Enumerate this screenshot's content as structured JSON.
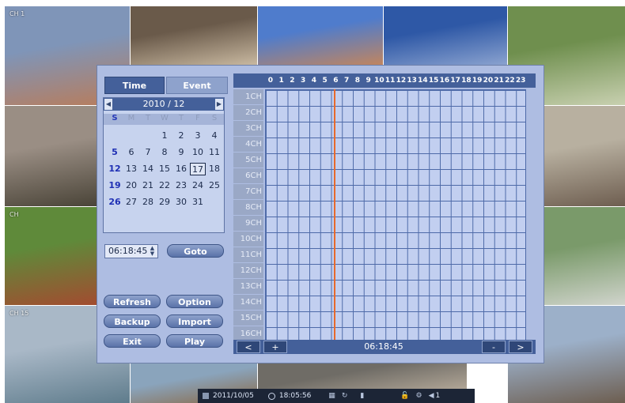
{
  "camera_tiles": [
    {
      "label": "CH 1",
      "colors": [
        "#7f95b8",
        "#b97c5a"
      ]
    },
    {
      "label": "",
      "colors": [
        "#6a5a4a",
        "#c8b8a0"
      ]
    },
    {
      "label": "",
      "colors": [
        "#4f7ccc",
        "#c08560"
      ]
    },
    {
      "label": "",
      "colors": [
        "#2e58a6",
        "#8aa2cf"
      ]
    },
    {
      "label": "",
      "colors": [
        "#6f8f4e",
        "#c8d0b0"
      ]
    },
    {
      "label": "",
      "colors": [
        "#9a8e84",
        "#4a4438"
      ]
    },
    {
      "label": "",
      "colors": [
        "#b8b0a0",
        "#6e5e50"
      ]
    },
    {
      "label": "CH",
      "colors": [
        "#5f8a3a",
        "#a24c30"
      ]
    },
    {
      "label": "",
      "colors": [
        "#7a9a6a",
        "#d0d4cc"
      ]
    },
    {
      "label": "CH 15",
      "colors": [
        "#a9b8c7",
        "#5f7c8c"
      ]
    },
    {
      "label": "",
      "colors": [
        "#8aa4bc",
        "#8a6a48"
      ]
    },
    {
      "label": "",
      "colors": [
        "#6f6c66",
        "#b0a596"
      ]
    },
    {
      "label": "",
      "colors": [
        "#9cb0c9",
        "#6d5e50"
      ]
    }
  ],
  "status_bar": {
    "date": "2011/10/05",
    "time": "18:05:56",
    "channel": "1"
  },
  "tabs": [
    {
      "label": "Time",
      "active": true
    },
    {
      "label": "Event",
      "active": false
    }
  ],
  "calendar": {
    "month_label": "2010 / 12",
    "weekdays": [
      "S",
      "M",
      "T",
      "W",
      "T",
      "F",
      "S"
    ],
    "weeks": [
      [
        "",
        "",
        "",
        "1",
        "2",
        "3",
        "4"
      ],
      [
        "5",
        "6",
        "7",
        "8",
        "9",
        "10",
        "11"
      ],
      [
        "12",
        "13",
        "14",
        "15",
        "16",
        "17",
        "18"
      ],
      [
        "19",
        "20",
        "21",
        "22",
        "23",
        "24",
        "25"
      ],
      [
        "26",
        "27",
        "28",
        "29",
        "30",
        "31",
        ""
      ]
    ],
    "selected_day": "17"
  },
  "time_input": {
    "value": "06:18:45"
  },
  "goto_label": "Goto",
  "action_buttons": {
    "refresh": "Refresh",
    "option": "Option",
    "backup": "Backup",
    "import": "Import",
    "exit": "Exit",
    "play": "Play"
  },
  "timeline": {
    "hours": [
      "0",
      "1",
      "2",
      "3",
      "4",
      "5",
      "6",
      "7",
      "8",
      "9",
      "10",
      "11",
      "12",
      "13",
      "14",
      "15",
      "16",
      "17",
      "18",
      "19",
      "20",
      "21",
      "22",
      "23"
    ],
    "channels": [
      "1CH",
      "2CH",
      "3CH",
      "4CH",
      "5CH",
      "6CH",
      "7CH",
      "8CH",
      "9CH",
      "10CH",
      "11CH",
      "12CH",
      "13CH",
      "14CH",
      "15CH",
      "16CH"
    ],
    "current_hour": 6.3,
    "current_time": "06:18:45"
  },
  "nav": {
    "prev": "<",
    "zoom_in": "+",
    "zoom_out": "-",
    "next": ">"
  }
}
